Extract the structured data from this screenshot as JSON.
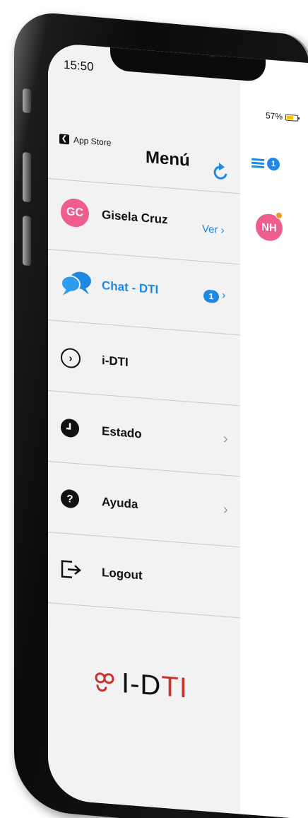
{
  "status": {
    "time": "15:50",
    "battery": "57%"
  },
  "nav": {
    "back_label": "App Store",
    "title": "Menú"
  },
  "profile": {
    "initials": "GC",
    "name": "Gisela Cruz",
    "link_label": "Ver ›"
  },
  "menu": {
    "chat": {
      "label": "Chat - DTI",
      "badge": "1",
      "chevron": "›"
    },
    "idti": {
      "label": "i-DTI"
    },
    "estado": {
      "label": "Estado"
    },
    "ayuda": {
      "label": "Ayuda",
      "icon_glyph": "?"
    },
    "logout": {
      "label": "Logout"
    }
  },
  "logo": {
    "symbol": "∞",
    "text_prefix": "I-D",
    "text_suffix": "TI"
  },
  "right_panel": {
    "menu_badge": "1",
    "contact_initials": "NH"
  },
  "colors": {
    "accent": "#1e88e5",
    "avatar": "#ee5d8d",
    "logo_red": "#c8332e",
    "online": "#f59a1e",
    "panel_bg": "#f2f2f2"
  },
  "icons": [
    "back-chevron-icon",
    "refresh-icon",
    "chat-bubbles-icon",
    "circle-chevron-icon",
    "clock-icon",
    "help-icon",
    "logout-icon",
    "hamburger-icon"
  ]
}
